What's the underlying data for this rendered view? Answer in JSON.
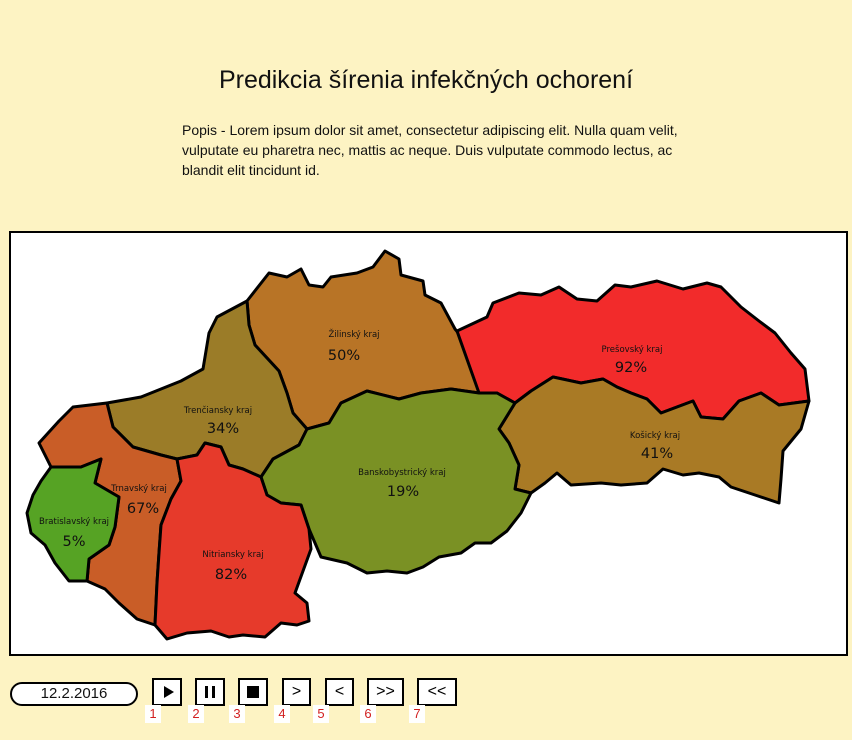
{
  "header": {
    "title": "Predikcia šírenia infekčných ochorení",
    "description": "Popis - Lorem ipsum dolor sit amet, consectetur adipiscing elit. Nulla quam velit, vulputate eu pharetra nec, mattis ac neque. Duis vulputate commodo lectus, ac blandit elit tincidunt id."
  },
  "map": {
    "regions": [
      {
        "name": "Žilinský kraj",
        "value": "50%",
        "color": "#b87426"
      },
      {
        "name": "Prešovský kraj",
        "value": "92%",
        "color": "#f22b2b"
      },
      {
        "name": "Trenčiansky kraj",
        "value": "34%",
        "color": "#9b7c28"
      },
      {
        "name": "Košický kraj",
        "value": "41%",
        "color": "#a97a25"
      },
      {
        "name": "Banskobystrický kraj",
        "value": "19%",
        "color": "#7a9124"
      },
      {
        "name": "Trnavský kraj",
        "value": "67%",
        "color": "#c95d27"
      },
      {
        "name": "Bratislavský kraj",
        "value": "5%",
        "color": "#56a324"
      },
      {
        "name": "Nitriansky kraj",
        "value": "82%",
        "color": "#e63a2b"
      }
    ]
  },
  "controls": {
    "date": "12.2.2016",
    "buttons": [
      {
        "icon": "play-icon",
        "label": "",
        "number": "1"
      },
      {
        "icon": "pause-icon",
        "label": "",
        "number": "2"
      },
      {
        "icon": "stop-icon",
        "label": "",
        "number": "3"
      },
      {
        "icon": "",
        "label": ">",
        "number": "4"
      },
      {
        "icon": "",
        "label": "<",
        "number": "5"
      },
      {
        "icon": "",
        "label": ">>",
        "number": "6"
      },
      {
        "icon": "",
        "label": "<<",
        "number": "7"
      }
    ]
  }
}
